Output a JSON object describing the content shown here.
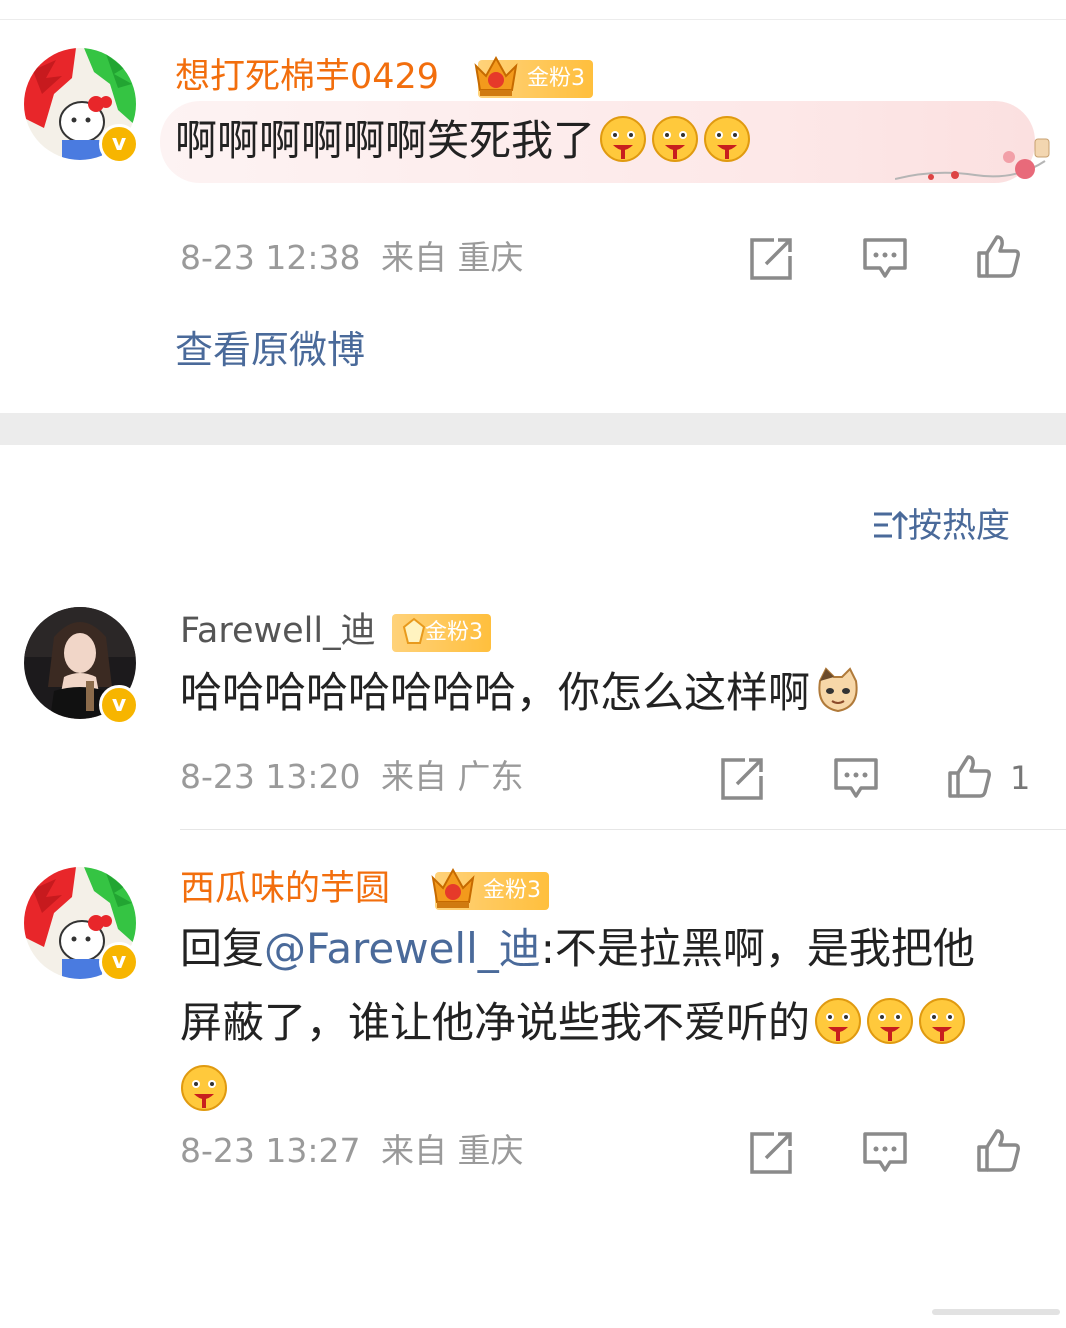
{
  "comments": [
    {
      "username": "想打死棉芋0429",
      "badge": "金粉3",
      "text": "啊啊啊啊啊啊笑死我了",
      "emoji_count": 3,
      "time": "8-23 12:38",
      "location": "来自 重庆",
      "view_original": "查看原微博",
      "likes": ""
    },
    {
      "username": "Farewell_迪",
      "badge": "金粉3",
      "text": "哈哈哈哈哈哈哈哈，你怎么这样啊",
      "emoji": "cat-face",
      "time": "8-23 13:20",
      "location": "来自 广东",
      "likes": "1"
    },
    {
      "username": "西瓜味的芋圆",
      "badge": "金粉3",
      "reply_prefix": "回复",
      "mention": "@Farewell_迪",
      "text_line1": ":不是拉黑啊，是我把他",
      "text_line2": "屏蔽了，谁让他净说些我不爱听的",
      "emoji_count": 4,
      "time": "8-23 13:27",
      "location": "来自 重庆",
      "likes": ""
    }
  ],
  "sort_label": "按热度",
  "icons": [
    "verified-icon",
    "fan-crown-icon",
    "repost-icon",
    "comment-icon",
    "like-icon",
    "sort-icon"
  ],
  "colors": {
    "username_orange": "#f26e0d",
    "link_blue": "#4a6a9a",
    "meta_gray": "#9a9a9a",
    "badge_gold": "#ffbf3d"
  }
}
